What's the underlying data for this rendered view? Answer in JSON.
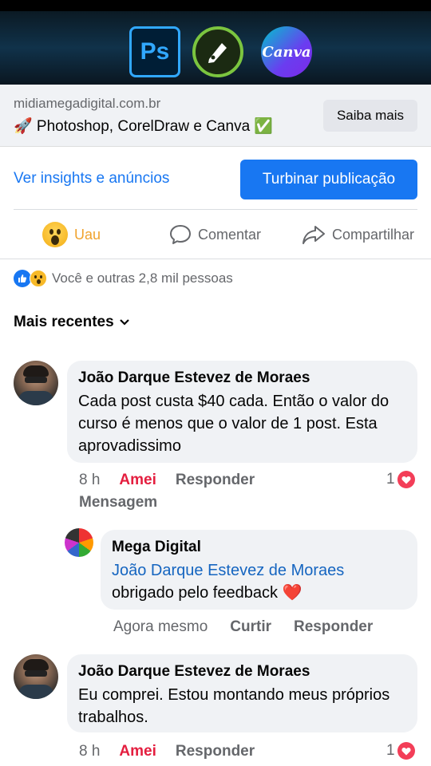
{
  "link_preview": {
    "banner_icons": [
      "Ps",
      "Canva"
    ],
    "domain": "midiamegadigital.com.br",
    "title": "🚀 Photoshop, CorelDraw e Canva ✅",
    "cta_label": "Saiba mais"
  },
  "post_tools": {
    "insights_label": "Ver insights e anúncios",
    "boost_label": "Turbinar publicação"
  },
  "actions": {
    "reaction_label": "Uau",
    "comment_label": "Comentar",
    "share_label": "Compartilhar"
  },
  "reactions_summary": "Você e outras 2,8 mil pessoas",
  "sort_label": "Mais recentes",
  "comments": [
    {
      "author": "João Darque Estevez de Moraes",
      "text": "Cada post custa $40 cada. Então o valor do curso é menos que o valor de 1 post. Esta aprovadissimo",
      "time": "8 h",
      "reaction": "Amei",
      "reply": "Responder",
      "message": "Mensagem",
      "count": "1",
      "reply_comment": {
        "author": "Mega Digital",
        "mention": "João Darque Estevez de Moraes",
        "text": "obrigado pelo feedback ❤️",
        "time": "Agora mesmo",
        "like": "Curtir",
        "reply": "Responder"
      }
    },
    {
      "author": "João Darque Estevez de Moraes",
      "text": "Eu comprei. Estou montando meus próprios trabalhos.",
      "time": "8 h",
      "reaction": "Amei",
      "reply": "Responder",
      "count": "1"
    }
  ],
  "colors": {
    "facebook_blue": "#1877f2",
    "love_red": "#e41e3f",
    "bubble_gray": "#f0f2f5"
  }
}
